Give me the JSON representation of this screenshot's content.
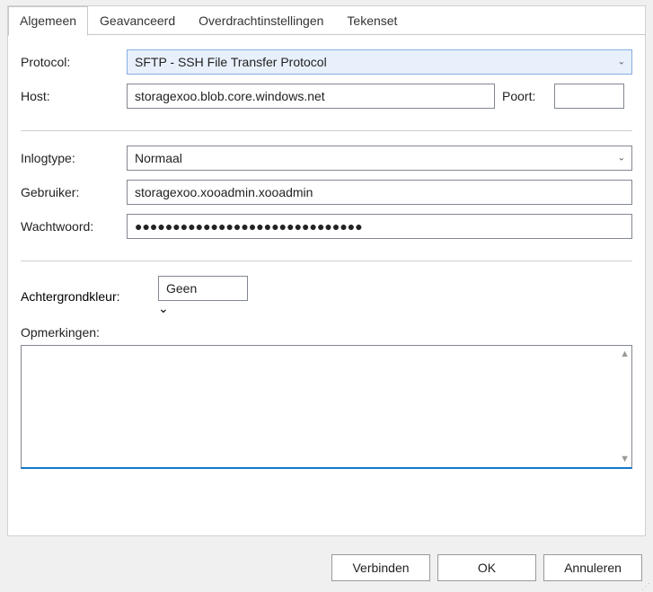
{
  "tabs": {
    "general": "Algemeen",
    "advanced": "Geavanceerd",
    "transfer": "Overdrachtinstellingen",
    "charset": "Tekenset"
  },
  "labels": {
    "protocol": "Protocol:",
    "host": "Host:",
    "port": "Poort:",
    "logonType": "Inlogtype:",
    "user": "Gebruiker:",
    "password": "Wachtwoord:",
    "bgcolor": "Achtergrondkleur:",
    "comments": "Opmerkingen:"
  },
  "values": {
    "protocol": "SFTP - SSH File Transfer Protocol",
    "host": "storagexoo.blob.core.windows.net",
    "port": "",
    "logonType": "Normaal",
    "user": "storagexoo.xooadmin.xooadmin",
    "password": "●●●●●●●●●●●●●●●●●●●●●●●●●●●●●●",
    "bgcolor": "Geen",
    "comments": ""
  },
  "buttons": {
    "connect": "Verbinden",
    "ok": "OK",
    "cancel": "Annuleren"
  }
}
